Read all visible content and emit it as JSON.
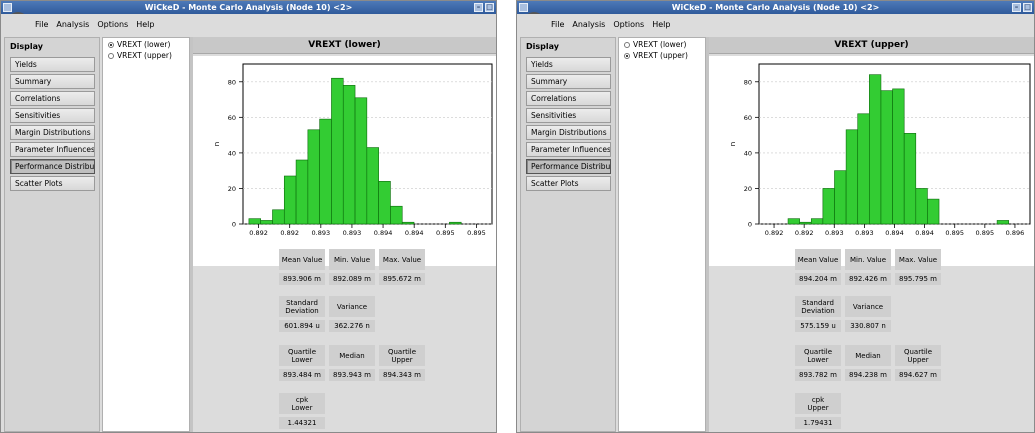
{
  "windows": [
    {
      "title": "WiCkeD - Monte Carlo Analysis (Node 10) <2>",
      "menu": [
        "File",
        "Analysis",
        "Options",
        "Help"
      ],
      "display_title": "Display",
      "nav": [
        "Yields",
        "Summary",
        "Correlations",
        "Sensitivities",
        "Margin Distributions",
        "Parameter Influences",
        "Performance Distributions",
        "Scatter Plots"
      ],
      "active_nav": "Performance Distributions",
      "performances": [
        {
          "label": "VREXT (lower)",
          "selected": true
        },
        {
          "label": "VREXT (upper)",
          "selected": false
        }
      ],
      "plot_title": "VREXT (lower)",
      "stats": {
        "mean_label": "Mean Value",
        "mean": "893.906 m",
        "min_label": "Min. Value",
        "min": "892.089 m",
        "max_label": "Max. Value",
        "max": "895.672 m",
        "std_label": "Standard\nDeviation",
        "std": "601.894 u",
        "var_label": "Variance",
        "var": "362.276 n",
        "ql_label": "Quartile\nLower",
        "ql": "893.484 m",
        "median_label": "Median",
        "median": "893.943 m",
        "qu_label": "Quartile\nUpper",
        "qu": "894.343 m",
        "cpk_label": "cpk\nLower",
        "cpk": "1.44321"
      }
    },
    {
      "title": "WiCkeD - Monte Carlo Analysis (Node 10) <2>",
      "menu": [
        "File",
        "Analysis",
        "Options",
        "Help"
      ],
      "display_title": "Display",
      "nav": [
        "Yields",
        "Summary",
        "Correlations",
        "Sensitivities",
        "Margin Distributions",
        "Parameter Influences",
        "Performance Distributions",
        "Scatter Plots"
      ],
      "active_nav": "Performance Distributions",
      "performances": [
        {
          "label": "VREXT (lower)",
          "selected": false
        },
        {
          "label": "VREXT (upper)",
          "selected": true
        }
      ],
      "plot_title": "VREXT (upper)",
      "stats": {
        "mean_label": "Mean Value",
        "mean": "894.204 m",
        "min_label": "Min. Value",
        "min": "892.426 m",
        "max_label": "Max. Value",
        "max": "895.795 m",
        "std_label": "Standard\nDeviation",
        "std": "575.159 u",
        "var_label": "Variance",
        "var": "330.807 n",
        "ql_label": "Quartile\nLower",
        "ql": "893.782 m",
        "median_label": "Median",
        "median": "894.238 m",
        "qu_label": "Quartile\nUpper",
        "qu": "894.627 m",
        "cpk_label": "cpk\nUpper",
        "cpk": "1.79431"
      }
    }
  ],
  "chart_data": [
    {
      "type": "bar",
      "ylabel": "n",
      "xticks": [
        "0.892",
        "0.892",
        "0.893",
        "0.893",
        "0.894",
        "0.894",
        "0.895",
        "0.895"
      ],
      "xlim": [
        0.8919,
        0.8957
      ],
      "ylim": [
        0,
        90
      ],
      "yticks": [
        0,
        20,
        40,
        60,
        80
      ],
      "bin_width": 0.00018,
      "bins": [
        0.89199,
        0.89217,
        0.89235,
        0.89253,
        0.89271,
        0.89289,
        0.89307,
        0.89325,
        0.89343,
        0.89361,
        0.89379,
        0.89397,
        0.89415,
        0.89433,
        0.89451,
        0.89469,
        0.89487,
        0.89505
      ],
      "values": [
        3,
        2,
        8,
        27,
        36,
        53,
        59,
        82,
        78,
        71,
        43,
        24,
        10,
        1,
        0,
        0,
        0,
        1
      ],
      "bar_color": "#33cc33",
      "grid": true
    },
    {
      "type": "bar",
      "ylabel": "n",
      "xticks": [
        "0.892",
        "0.892",
        "0.893",
        "0.893",
        "0.894",
        "0.894",
        "0.895",
        "0.895",
        "0.896"
      ],
      "xlim": [
        0.8919,
        0.8961
      ],
      "ylim": [
        0,
        90
      ],
      "yticks": [
        0,
        20,
        40,
        60,
        80
      ],
      "bin_width": 0.00018,
      "bins": [
        0.89235,
        0.89253,
        0.89271,
        0.89289,
        0.89307,
        0.89325,
        0.89343,
        0.89361,
        0.89379,
        0.89397,
        0.89415,
        0.89433,
        0.89451,
        0.89469,
        0.89487,
        0.89505,
        0.89523,
        0.89541,
        0.89559
      ],
      "values": [
        3,
        1,
        3,
        20,
        30,
        53,
        62,
        84,
        75,
        76,
        51,
        20,
        14,
        0,
        0,
        0,
        0,
        0,
        2
      ],
      "bar_color": "#33cc33",
      "grid": true
    }
  ]
}
